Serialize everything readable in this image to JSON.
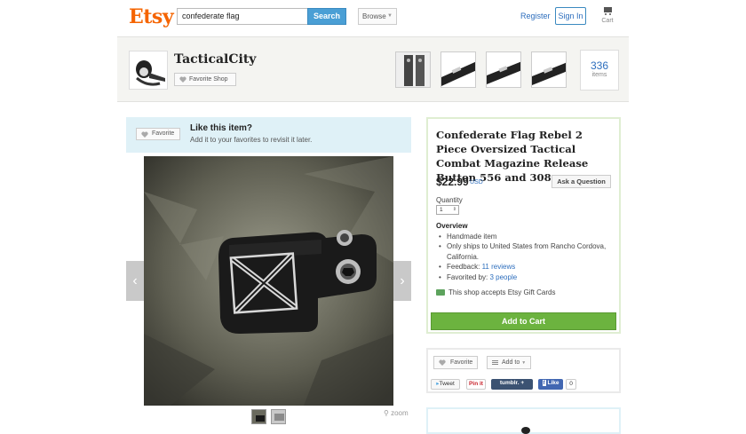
{
  "header": {
    "logo": "Etsy",
    "search_value": "confederate flag",
    "search_button": "Search",
    "browse": "Browse",
    "register": "Register",
    "sign_in": "Sign In",
    "cart": "Cart"
  },
  "shop": {
    "name": "TacticalCity",
    "favorite_shop": "Favorite Shop",
    "items_count": "336",
    "items_label": "items"
  },
  "like_panel": {
    "favorite": "Favorite",
    "title": "Like this item?",
    "subtitle": "Add it to your favorites to revisit it later."
  },
  "photo": {
    "zoom": "zoom"
  },
  "listing": {
    "title": "Confederate Flag Rebel 2 Piece Oversized Tactical Combat Magazine Release Button 556 and 308",
    "price": "$22.99",
    "currency": "USD",
    "ask_question": "Ask a Question",
    "quantity_label": "Quantity",
    "quantity_value": "1",
    "overview_title": "Overview",
    "overview": {
      "handmade": "Handmade item",
      "ships": "Only ships to United States from Rancho Cordova, California.",
      "feedback_prefix": "Feedback: ",
      "feedback_link": "11 reviews",
      "favorited_prefix": "Favorited by: ",
      "favorited_link": "3 people"
    },
    "gift_cards": "This shop accepts Etsy Gift Cards",
    "add_to_cart": "Add to Cart"
  },
  "social": {
    "favorite": "Favorite",
    "add_to": "Add to",
    "tweet": "Tweet",
    "pin_it": "Pin it",
    "tumblr": "tumblr.",
    "like": "Like",
    "like_count": "0"
  },
  "colors": {
    "brand": "#f56400",
    "link": "#2d6ebd",
    "search_button": "#4a9fd5",
    "add_to_cart": "#6cb33f",
    "like_panel_bg": "#dff1f7"
  }
}
